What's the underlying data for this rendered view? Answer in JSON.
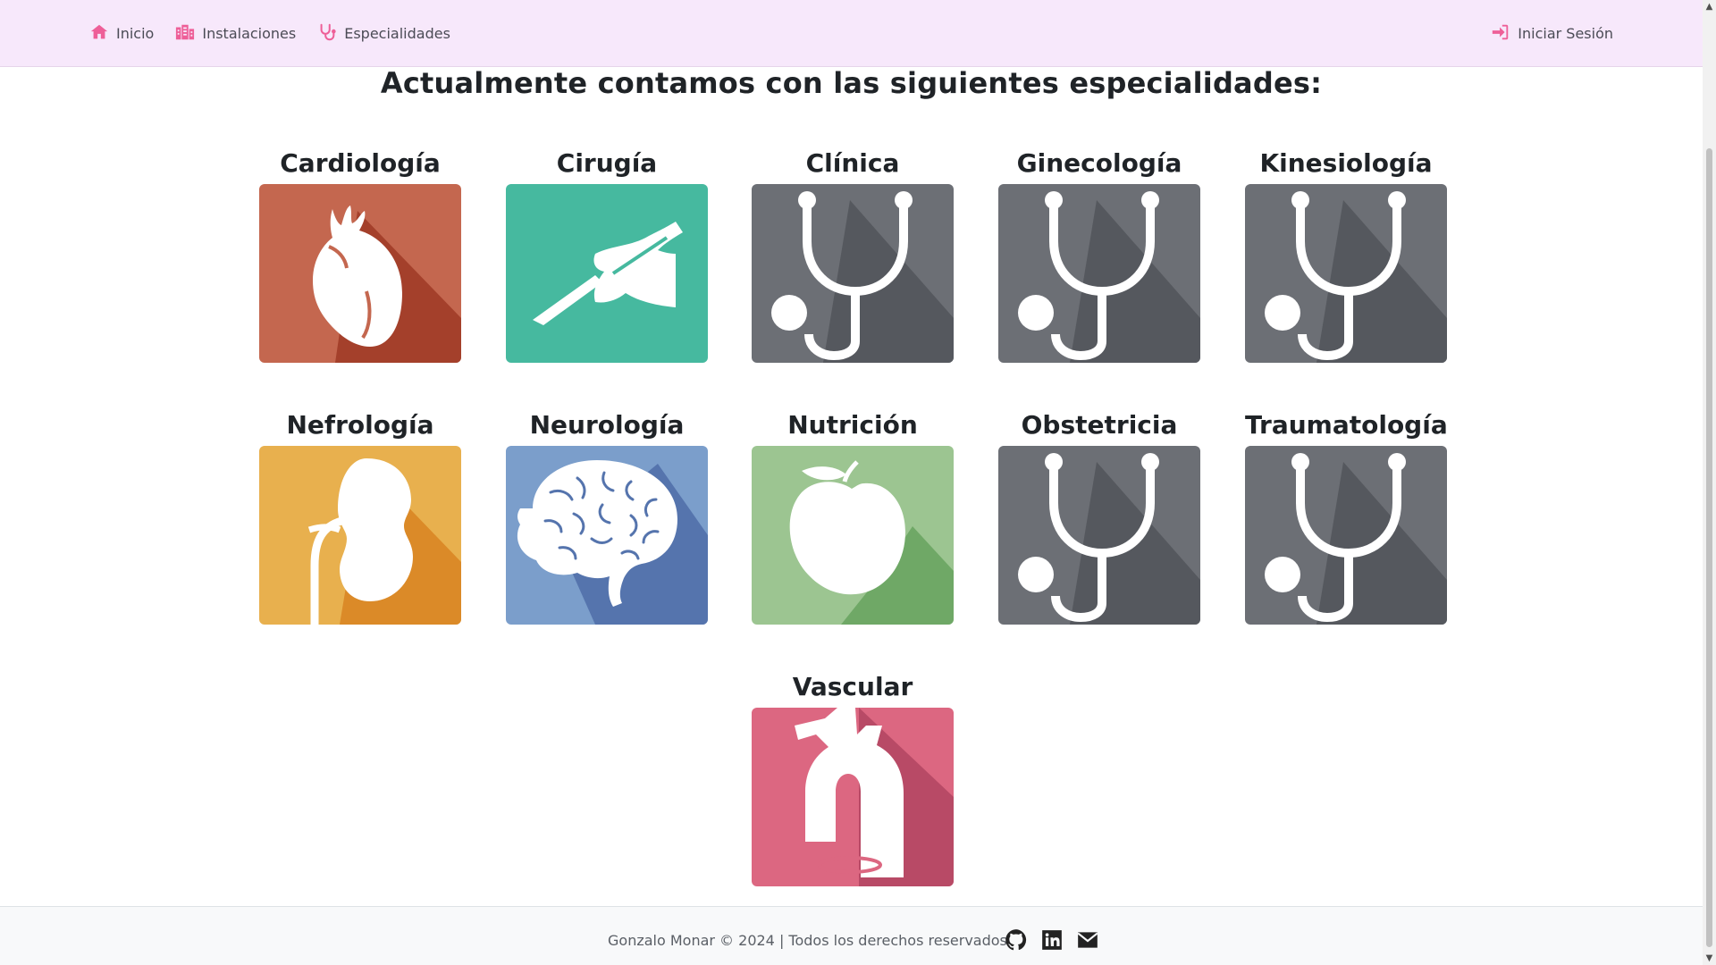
{
  "nav": {
    "inicio": "Inicio",
    "instalaciones": "Instalaciones",
    "especialidades": "Especialidades",
    "login": "Iniciar Sesión"
  },
  "page_title": "Actualmente contamos con las siguientes especialidades:",
  "specialties": [
    {
      "label": "Cardiología",
      "icon": "heart-icon",
      "color": "#c4674f"
    },
    {
      "label": "Cirugía",
      "icon": "scalpel-hand-icon",
      "color": "#46b99f"
    },
    {
      "label": "Clínica",
      "icon": "stethoscope-icon",
      "color": "#6c6f75"
    },
    {
      "label": "Ginecología",
      "icon": "stethoscope-icon",
      "color": "#6c6f75"
    },
    {
      "label": "Kinesiología",
      "icon": "stethoscope-icon",
      "color": "#6c6f75"
    },
    {
      "label": "Nefrología",
      "icon": "kidney-icon",
      "color": "#e8b04e"
    },
    {
      "label": "Neurología",
      "icon": "brain-icon",
      "color": "#7b9ecb"
    },
    {
      "label": "Nutrición",
      "icon": "apple-icon",
      "color": "#9cc591"
    },
    {
      "label": "Obstetricia",
      "icon": "stethoscope-icon",
      "color": "#6c6f75"
    },
    {
      "label": "Traumatología",
      "icon": "stethoscope-icon",
      "color": "#6c6f75"
    },
    {
      "label": "Vascular",
      "icon": "aorta-icon",
      "color": "#dc6781"
    }
  ],
  "footer": {
    "text": "Gonzalo Monar © 2024 | Todos los derechos reservados",
    "social": [
      "github-icon",
      "linkedin-icon",
      "envelope-icon"
    ]
  }
}
